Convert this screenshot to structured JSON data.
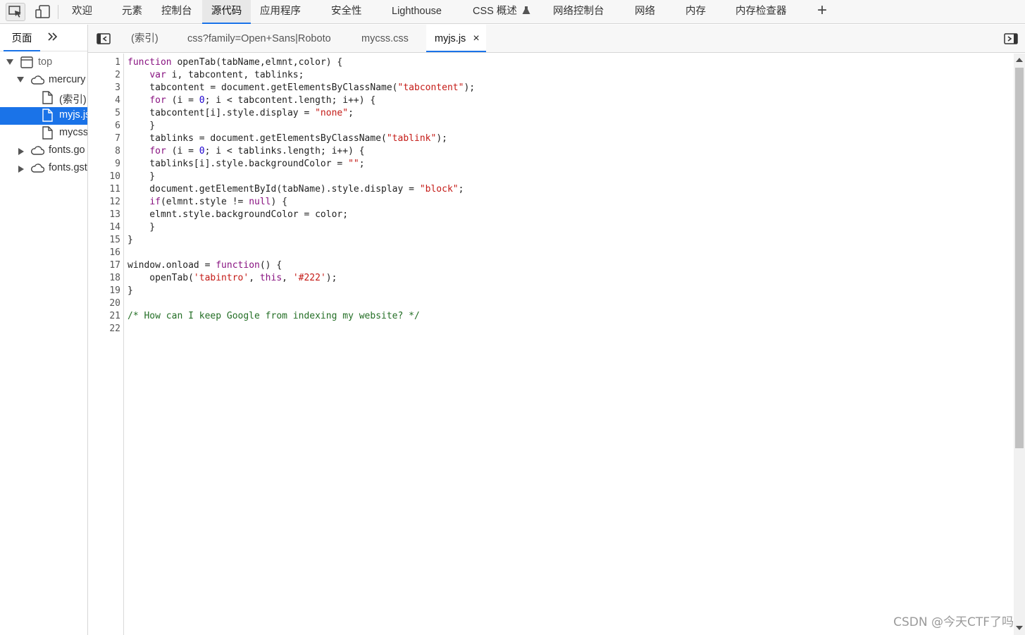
{
  "toolbar": {
    "inspect_icon": "inspect-element-icon",
    "device_icon": "device-toolbar-icon",
    "tabs": [
      {
        "label": "欢迎"
      },
      {
        "label": "元素"
      },
      {
        "label": "控制台"
      },
      {
        "label": "源代码",
        "active": true
      },
      {
        "label": "应用程序"
      },
      {
        "label": "安全性"
      },
      {
        "label": "Lighthouse"
      },
      {
        "label": "CSS 概述"
      },
      {
        "label": "网络控制台"
      },
      {
        "label": "网络"
      },
      {
        "label": "内存"
      },
      {
        "label": "内存检查器"
      }
    ],
    "add_tab": "+"
  },
  "navigator": {
    "tab_page": "页面",
    "more": "»",
    "tree": [
      {
        "label": "top",
        "icon": "frame-icon",
        "expanded": true
      },
      {
        "label": "mercury",
        "icon": "cloud-icon",
        "expanded": true
      },
      {
        "label": "(索引)",
        "icon": "file-icon"
      },
      {
        "label": "myjs.js",
        "icon": "file-icon",
        "selected": true
      },
      {
        "label": "mycss",
        "icon": "file-icon"
      },
      {
        "label": "fonts.go",
        "icon": "cloud-icon",
        "expanded": false
      },
      {
        "label": "fonts.gst",
        "icon": "cloud-icon",
        "expanded": false
      }
    ]
  },
  "files": {
    "tabs": [
      {
        "label": "(索引)"
      },
      {
        "label": "css?family=Open+Sans|Roboto"
      },
      {
        "label": "mycss.css"
      },
      {
        "label": "myjs.js",
        "active": true,
        "close": "×"
      }
    ]
  },
  "editor": {
    "lines": [
      "function openTab(tabName,elmnt,color) {",
      "    var i, tabcontent, tablinks;",
      "    tabcontent = document.getElementsByClassName(\"tabcontent\");",
      "    for (i = 0; i < tabcontent.length; i++) {",
      "    tabcontent[i].style.display = \"none\";",
      "    }",
      "    tablinks = document.getElementsByClassName(\"tablink\");",
      "    for (i = 0; i < tablinks.length; i++) {",
      "    tablinks[i].style.backgroundColor = \"\";",
      "    }",
      "    document.getElementById(tabName).style.display = \"block\";",
      "    if(elmnt.style != null) {",
      "    elmnt.style.backgroundColor = color;",
      "    }",
      "}",
      "",
      "window.onload = function() {",
      "    openTab('tabintro', this, '#222');",
      "}",
      "",
      "/* How can I keep Google from indexing my website? */",
      ""
    ]
  },
  "watermark": "CSDN @今天CTF了吗",
  "colors": {
    "accent": "#1a73e8",
    "keyword": "#881280",
    "string": "#c41a16",
    "number": "#1c00cf",
    "comment": "#236e25"
  }
}
